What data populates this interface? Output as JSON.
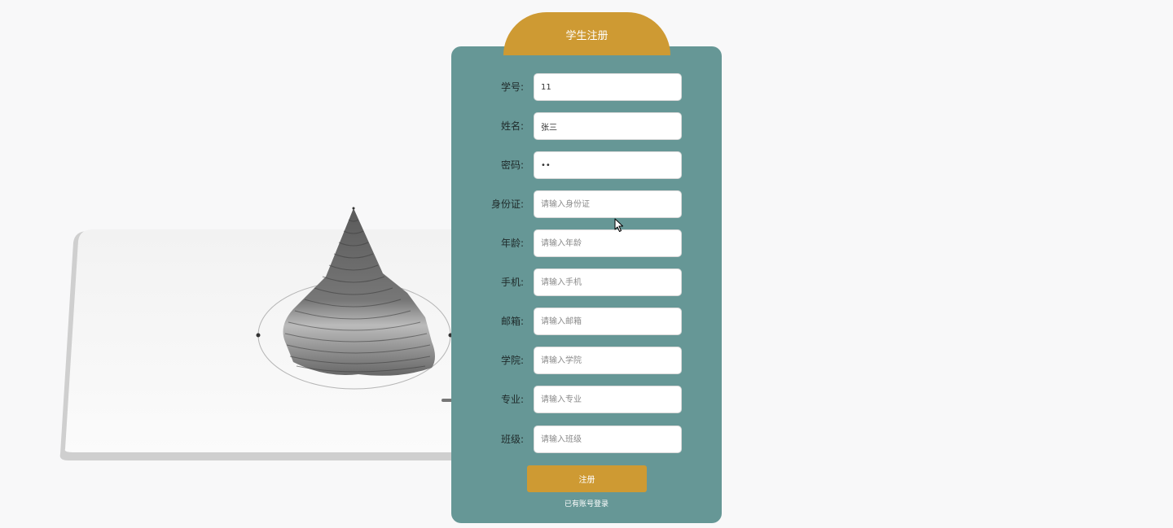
{
  "form": {
    "title": "学生注册",
    "fields": [
      {
        "key": "student_id",
        "label": "学号:",
        "value": "11",
        "placeholder": "",
        "type": "text"
      },
      {
        "key": "name",
        "label": "姓名:",
        "value": "张三",
        "placeholder": "",
        "type": "text"
      },
      {
        "key": "password",
        "label": "密码:",
        "value": "11",
        "placeholder": "",
        "type": "password"
      },
      {
        "key": "id_card",
        "label": "身份证:",
        "value": "",
        "placeholder": "请输入身份证",
        "type": "text"
      },
      {
        "key": "age",
        "label": "年龄:",
        "value": "",
        "placeholder": "请输入年龄",
        "type": "text"
      },
      {
        "key": "phone",
        "label": "手机:",
        "value": "",
        "placeholder": "请输入手机",
        "type": "text"
      },
      {
        "key": "email",
        "label": "邮箱:",
        "value": "",
        "placeholder": "请输入邮箱",
        "type": "text"
      },
      {
        "key": "college",
        "label": "学院:",
        "value": "",
        "placeholder": "请输入学院",
        "type": "text"
      },
      {
        "key": "major",
        "label": "专业:",
        "value": "",
        "placeholder": "请输入专业",
        "type": "text"
      },
      {
        "key": "class_name",
        "label": "班级:",
        "value": "",
        "placeholder": "请输入班级",
        "type": "text"
      }
    ],
    "submit_label": "注册",
    "login_link": "已有账号登录"
  },
  "colors": {
    "card": "#669796",
    "accent": "#ce9a33",
    "page_bg": "#f8f8f9"
  },
  "icons": [
    "mouse-pointer-icon"
  ]
}
